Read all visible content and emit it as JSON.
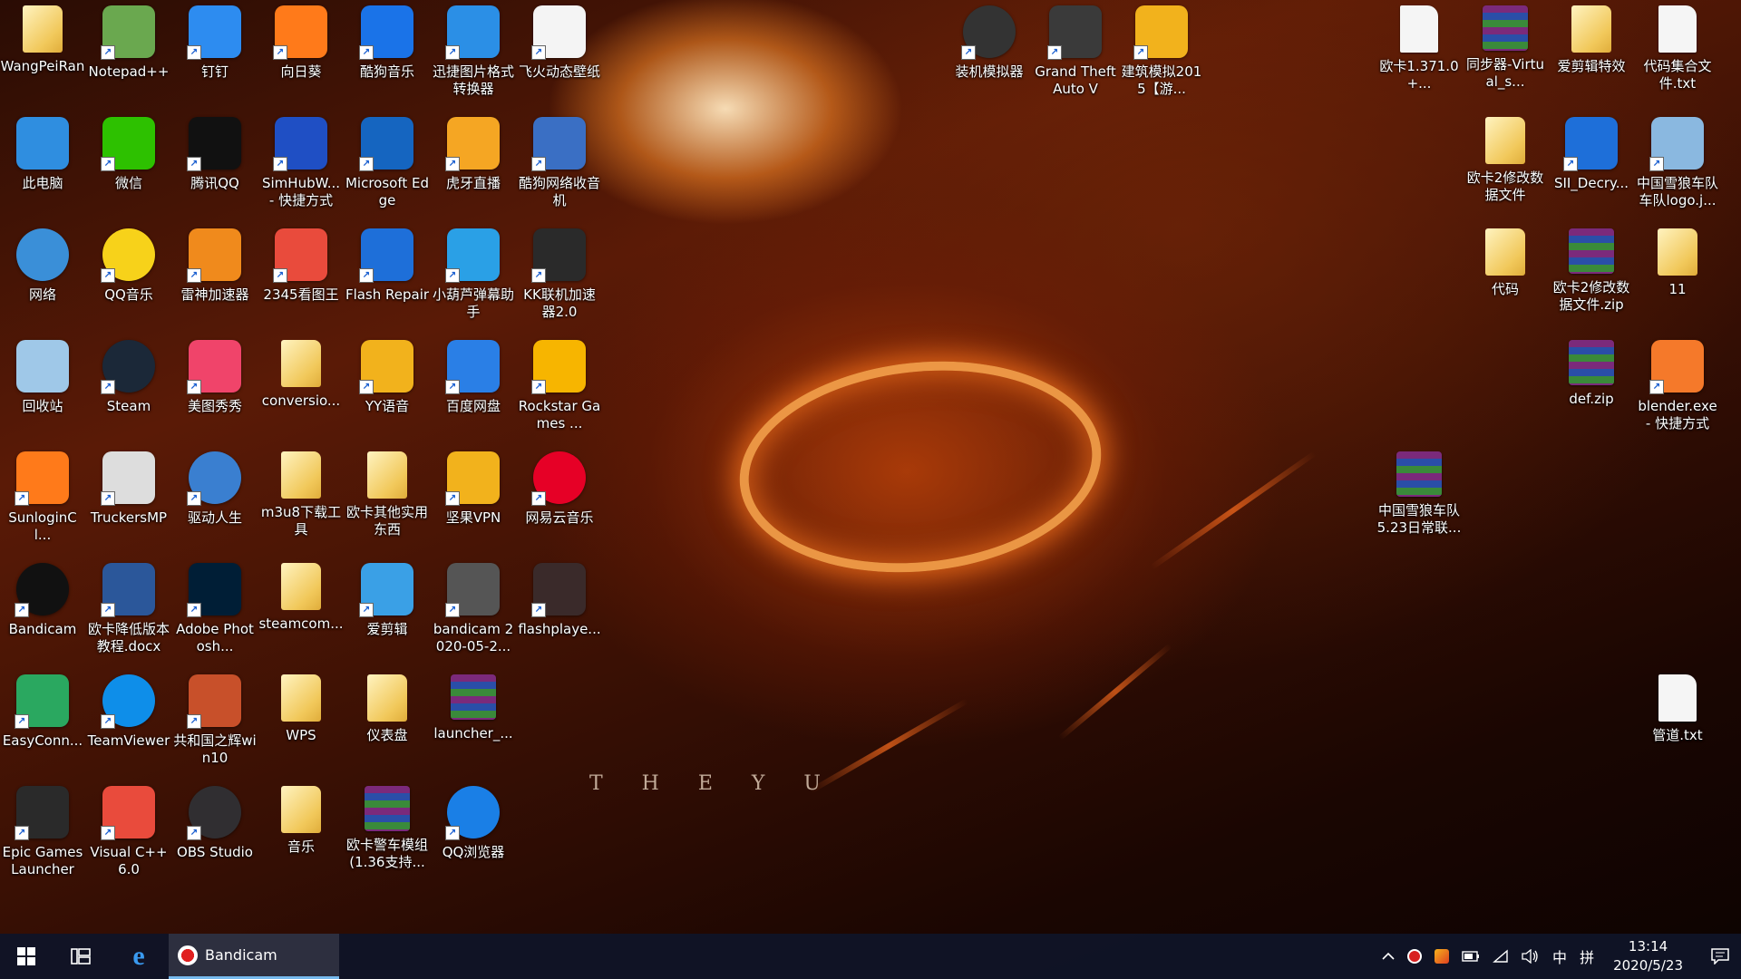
{
  "wallpaper": {
    "text": "T H E Y   U"
  },
  "desktop_icons": [
    {
      "label": "WangPeiRan",
      "icon": "user-folder-icon",
      "color": "#e8b94a"
    },
    {
      "label": "Notepad++",
      "icon": "notepad-plus-plus-icon",
      "color": "#6aa84f"
    },
    {
      "label": "钉钉",
      "icon": "dingtalk-icon",
      "color": "#2d8cf0"
    },
    {
      "label": "向日葵",
      "icon": "sunflower-icon",
      "color": "#ff7a1a"
    },
    {
      "label": "酷狗音乐",
      "icon": "kugou-music-icon",
      "color": "#1a73e8"
    },
    {
      "label": "迅捷图片格式转换器",
      "icon": "image-converter-icon",
      "color": "#2b8fe6"
    },
    {
      "label": "飞火动态壁纸",
      "icon": "feihuo-wallpaper-icon",
      "color": "#f4f4f4"
    },
    {
      "label": "此电脑",
      "icon": "this-pc-icon",
      "color": "#2f8ee0"
    },
    {
      "label": "微信",
      "icon": "wechat-icon",
      "color": "#2dc100"
    },
    {
      "label": "腾讯QQ",
      "icon": "qq-penguin-icon",
      "color": "#111111"
    },
    {
      "label": "SimHubW... - 快捷方式",
      "icon": "gamepad-icon",
      "color": "#1f4fc4"
    },
    {
      "label": "Microsoft Edge",
      "icon": "edge-icon",
      "color": "#1565c0"
    },
    {
      "label": "虎牙直播",
      "icon": "huya-live-icon",
      "color": "#f5a623"
    },
    {
      "label": "酷狗网络收音机",
      "icon": "kugou-radio-icon",
      "color": "#3a6fc4"
    },
    {
      "label": "网络",
      "icon": "network-globe-icon",
      "color": "#3a8fd8"
    },
    {
      "label": "QQ音乐",
      "icon": "qq-music-icon",
      "color": "#f7d21a"
    },
    {
      "label": "雷神加速器",
      "icon": "leishen-accelerator-icon",
      "color": "#f08a1c"
    },
    {
      "label": "2345看图王",
      "icon": "image-viewer-icon",
      "color": "#e94b3c"
    },
    {
      "label": "Flash Repair",
      "icon": "flash-repair-icon",
      "color": "#1e6fd9"
    },
    {
      "label": "小葫芦弹幕助手",
      "icon": "danmaku-helper-icon",
      "color": "#2aa0e6"
    },
    {
      "label": "KK联机加速器2.0",
      "icon": "kk-accelerator-icon",
      "color": "#2a2a2a"
    },
    {
      "label": "回收站",
      "icon": "recycle-bin-icon",
      "color": "#9fc8e8"
    },
    {
      "label": "Steam",
      "icon": "steam-icon",
      "color": "#1b2838"
    },
    {
      "label": "美图秀秀",
      "icon": "meitu-icon",
      "color": "#f0446a"
    },
    {
      "label": "conversio...",
      "icon": "folder-icon",
      "color": "#f1c85a"
    },
    {
      "label": "YY语音",
      "icon": "yy-voice-icon",
      "color": "#f2b21c"
    },
    {
      "label": "百度网盘",
      "icon": "baidu-netdisk-icon",
      "color": "#2a7fe6"
    },
    {
      "label": "Rockstar Games ...",
      "icon": "rockstar-icon",
      "color": "#f7b500"
    },
    {
      "label": "SunloginCl...",
      "icon": "sunlogin-icon",
      "color": "#ff7a1a"
    },
    {
      "label": "TruckersMP",
      "icon": "truckersmp-icon",
      "color": "#dddddd"
    },
    {
      "label": "驱动人生",
      "icon": "driver-gear-icon",
      "color": "#3a7fd0"
    },
    {
      "label": "m3u8下载工具",
      "icon": "folder-icon",
      "color": "#f1c85a"
    },
    {
      "label": "欧卡其他实用东西",
      "icon": "folder-icon",
      "color": "#f1c85a"
    },
    {
      "label": "坚果VPN",
      "icon": "vpn-shield-icon",
      "color": "#f2b21c"
    },
    {
      "label": "网易云音乐",
      "icon": "netease-music-icon",
      "color": "#e60026"
    },
    {
      "label": "Bandicam",
      "icon": "bandicam-icon",
      "color": "#111111"
    },
    {
      "label": "欧卡降低版本教程.docx",
      "icon": "word-document-icon",
      "color": "#2b579a"
    },
    {
      "label": "Adobe Photosh...",
      "icon": "photoshop-icon",
      "color": "#001e36"
    },
    {
      "label": "steamcom...",
      "icon": "folder-icon",
      "color": "#f1c85a"
    },
    {
      "label": "爱剪辑",
      "icon": "aijianji-icon",
      "color": "#3aa0e6"
    },
    {
      "label": "bandicam 2020-05-2...",
      "icon": "video-thumbnail-icon",
      "color": "#555555"
    },
    {
      "label": "flashplaye...",
      "icon": "flash-player-icon",
      "color": "#3a2a2a"
    },
    {
      "label": "EasyConn...",
      "icon": "easyconnect-icon",
      "color": "#2aa860"
    },
    {
      "label": "TeamViewer",
      "icon": "teamviewer-icon",
      "color": "#0e8ee9"
    },
    {
      "label": "共和国之辉win10",
      "icon": "rise-of-republic-icon",
      "color": "#c8502a"
    },
    {
      "label": "WPS",
      "icon": "folder-icon",
      "color": "#f1c85a"
    },
    {
      "label": "仪表盘",
      "icon": "folder-icon",
      "color": "#f1c85a"
    },
    {
      "label": "launcher_...",
      "icon": "winrar-archive-icon",
      "color": "#7b2a7b"
    },
    {
      "label": "Epic Games Launcher",
      "icon": "epic-games-icon",
      "color": "#2a2a2a"
    },
    {
      "label": "Visual C++ 6.0",
      "icon": "visual-cpp-icon",
      "color": "#e94b3c"
    },
    {
      "label": "OBS Studio",
      "icon": "obs-icon",
      "color": "#302e31"
    },
    {
      "label": "音乐",
      "icon": "folder-icon",
      "color": "#f1c85a"
    },
    {
      "label": "欧卡警车模组(1.36支持...",
      "icon": "winrar-archive-icon",
      "color": "#7b2a7b"
    },
    {
      "label": "QQ浏览器",
      "icon": "qq-browser-icon",
      "color": "#1a7fe6"
    },
    {
      "label": "装机模拟器",
      "icon": "pc-building-simulator-icon",
      "color": "#333333"
    },
    {
      "label": "Grand Theft Auto V",
      "icon": "gta5-icon",
      "color": "#3a3a3a"
    },
    {
      "label": "建筑模拟2015【游...",
      "icon": "construction-simulator-icon",
      "color": "#f2b21c"
    },
    {
      "label": "欧卡1.371.0+...",
      "icon": "file-icon",
      "color": "#f5f5f5"
    },
    {
      "label": "同步器-Virtual_s...",
      "icon": "winrar-archive-icon",
      "color": "#7b2a7b"
    },
    {
      "label": "爱剪辑特效",
      "icon": "folder-icon",
      "color": "#f1c85a"
    },
    {
      "label": "代码集合文件.txt",
      "icon": "text-file-icon",
      "color": "#f5f5f5"
    },
    {
      "label": "欧卡2修改数据文件",
      "icon": "folder-icon",
      "color": "#f1c85a"
    },
    {
      "label": "SII_Decry...",
      "icon": "sii-decrypt-icon",
      "color": "#1e6fd9"
    },
    {
      "label": "中国雪狼车队车队logo.j...",
      "icon": "image-file-icon",
      "color": "#8ab8e0"
    },
    {
      "label": "代码",
      "icon": "folder-icon",
      "color": "#f1c85a"
    },
    {
      "label": "欧卡2修改数据文件.zip",
      "icon": "winrar-archive-icon",
      "color": "#7b2a7b"
    },
    {
      "label": "11",
      "icon": "folder-icon",
      "color": "#f1c85a"
    },
    {
      "label": "def.zip",
      "icon": "winrar-archive-icon",
      "color": "#7b2a7b"
    },
    {
      "label": "blender.exe - 快捷方式",
      "icon": "blender-icon",
      "color": "#f5792a"
    },
    {
      "label": "中国雪狼车队5.23日常联...",
      "icon": "winrar-archive-icon",
      "color": "#7b2a7b"
    },
    {
      "label": "管道.txt",
      "icon": "text-file-icon",
      "color": "#f5f5f5"
    }
  ],
  "taskbar": {
    "start_icon": "windows-start-icon",
    "task_view_icon": "task-view-icon",
    "edge_icon": "edge-icon",
    "active_app": "Bandicam",
    "ime_language": "中",
    "ime_mode": "拼",
    "time": "13:14",
    "date": "2020/5/23",
    "accent": "#76b9ed"
  }
}
